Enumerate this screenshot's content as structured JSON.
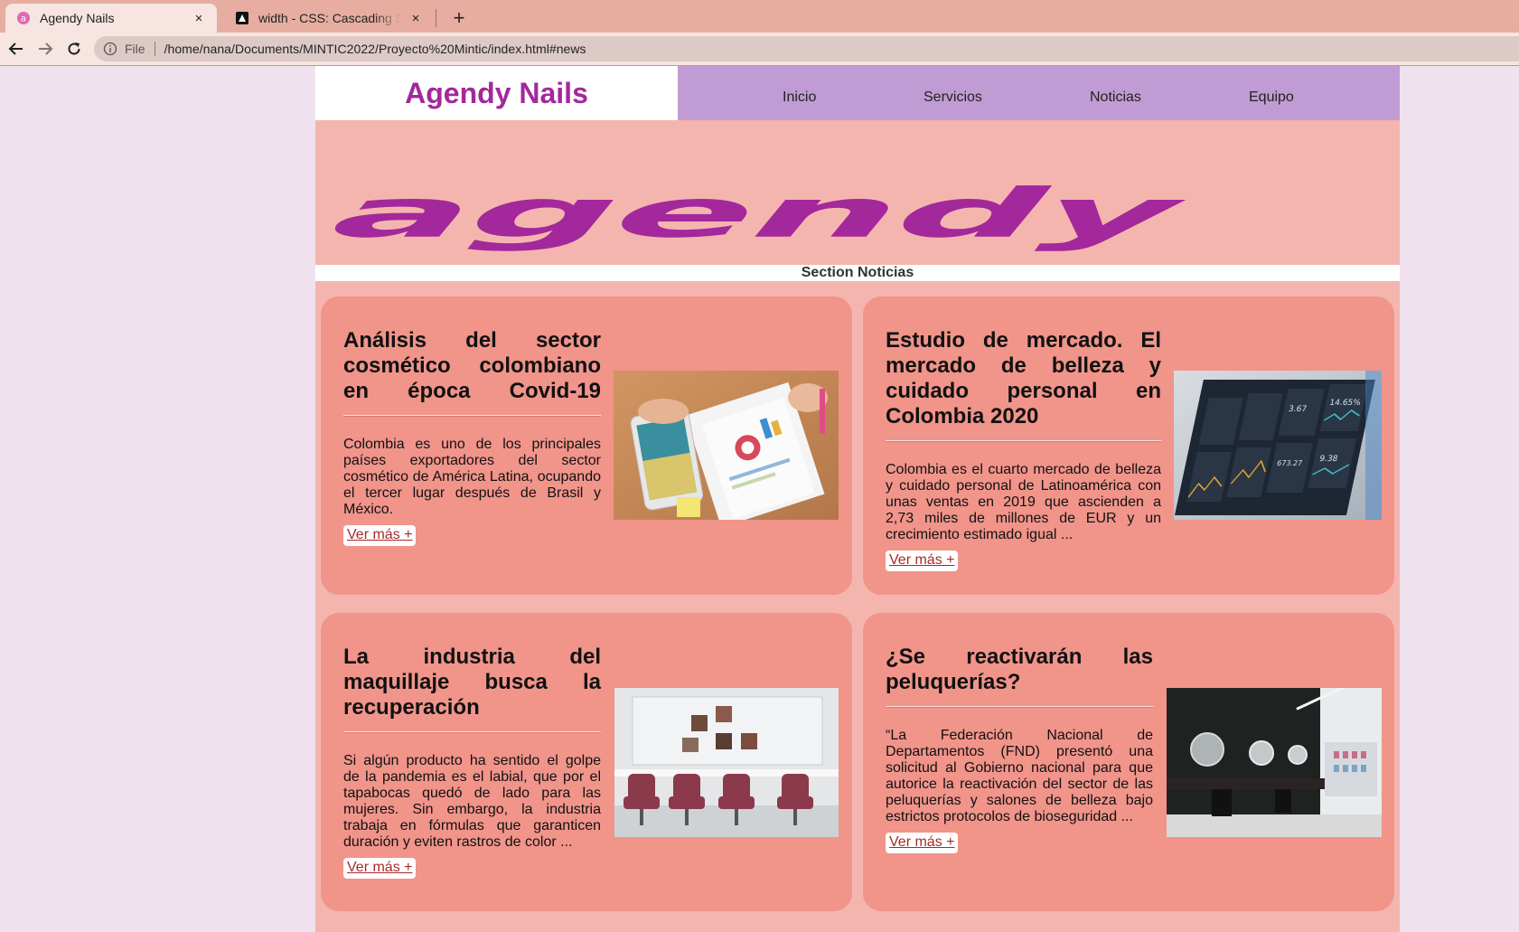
{
  "browser": {
    "tabs": [
      {
        "title": "Agendy Nails",
        "active": true,
        "icon": "agendy-favicon-icon"
      },
      {
        "title": "width - CSS: Cascading Sty",
        "active": false,
        "icon": "mdn-favicon-icon"
      }
    ],
    "new_tab_label": "+",
    "close_label": "×",
    "address": {
      "scheme_label": "File",
      "url": "/home/nana/Documents/MINTIC2022/Proyecto%20Mintic/index.html#news"
    }
  },
  "site": {
    "brand": "Agendy Nails",
    "nav": [
      "Inicio",
      "Servicios",
      "Noticias",
      "Equipo"
    ],
    "banner_logo": "agendy",
    "section_title": "Section Noticias",
    "colors": {
      "brand": "#a3289b",
      "nav_bg": "#c19bd4",
      "page_bg": "#f5b5af",
      "card_bg": "#f1948a",
      "link": "#a52a2a"
    }
  },
  "news": [
    {
      "title": "Análisis del sector cosmético colombiano en época Covid-19",
      "body": "Colombia es uno de los principales países exportadores del sector cosmético de América Latina, ocupando el tercer lugar después de Brasil y México.",
      "link": "Ver más +",
      "image": "desk-charts-photo"
    },
    {
      "title": "Estudio de mercado. El mercado de belleza y cuidado personal en Colombia 2020",
      "body": "Colombia es el cuarto mercado de belleza y cuidado personal de Latinoamérica con unas ventas en 2019 que ascienden a 2,73 miles de millones de EUR y un crecimiento estimado igual ...",
      "link": "Ver más +",
      "image": "dashboard-screen-photo",
      "screen_values": [
        "14.65%",
        "3.67",
        "673.27",
        "9.38"
      ]
    },
    {
      "title": "La industria del maquillaje busca la recuperación",
      "body": "Si algún producto ha sentido el golpe de la pandemia es el labial, que por el tapabocas quedó de lado para las mujeres. Sin embargo, la industria trabaja en fórmulas que garanticen duración y eviten rastros de color ...",
      "link": "Ver más +",
      "image": "salon-chairs-photo"
    },
    {
      "title": "¿Se reactivarán las peluquerías?",
      "body": "“La Federación Nacional de Departamentos (FND) presentó una solicitud al Gobierno nacional para que autorice la reactivación del sector de las peluquerías y salones de belleza bajo estrictos protocolos de bioseguridad ...",
      "link": "Ver más +",
      "image": "barbershop-photo"
    }
  ]
}
